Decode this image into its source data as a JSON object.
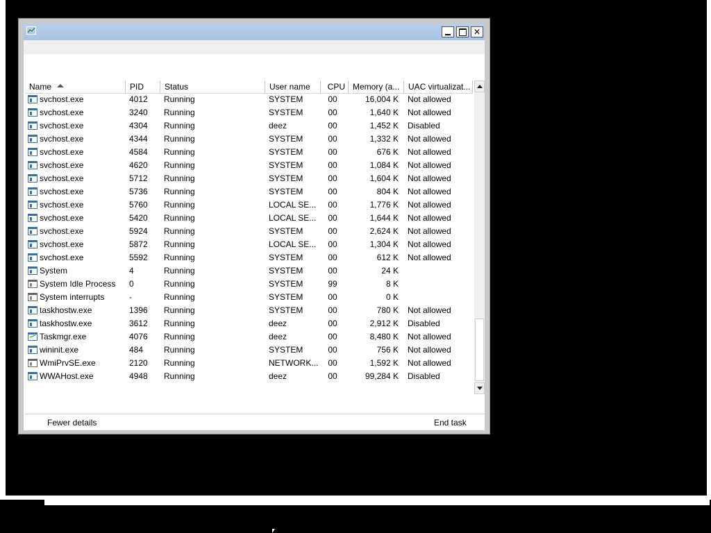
{
  "window": {
    "title": "",
    "minimize_symbol": "",
    "maximize_symbol": "",
    "close_symbol": "✕"
  },
  "columns": [
    {
      "label": "Name",
      "sorted": "ascending"
    },
    {
      "label": "PID"
    },
    {
      "label": "Status"
    },
    {
      "label": "User name"
    },
    {
      "label": "CPU"
    },
    {
      "label": "Memory (a..."
    },
    {
      "label": "UAC virtualizat..."
    }
  ],
  "processes": [
    {
      "icon": "window-icon",
      "name": "svchost.exe",
      "pid": "4012",
      "status": "Running",
      "user": "SYSTEM",
      "cpu": "00",
      "memory": "16,004 K",
      "uac": "Not allowed"
    },
    {
      "icon": "window-icon",
      "name": "svchost.exe",
      "pid": "3240",
      "status": "Running",
      "user": "SYSTEM",
      "cpu": "00",
      "memory": "1,640 K",
      "uac": "Not allowed"
    },
    {
      "icon": "window-icon",
      "name": "svchost.exe",
      "pid": "4304",
      "status": "Running",
      "user": "deez",
      "cpu": "00",
      "memory": "1,452 K",
      "uac": "Disabled"
    },
    {
      "icon": "window-icon",
      "name": "svchost.exe",
      "pid": "4344",
      "status": "Running",
      "user": "SYSTEM",
      "cpu": "00",
      "memory": "1,332 K",
      "uac": "Not allowed"
    },
    {
      "icon": "window-icon",
      "name": "svchost.exe",
      "pid": "4584",
      "status": "Running",
      "user": "SYSTEM",
      "cpu": "00",
      "memory": "676 K",
      "uac": "Not allowed"
    },
    {
      "icon": "window-icon",
      "name": "svchost.exe",
      "pid": "4620",
      "status": "Running",
      "user": "SYSTEM",
      "cpu": "00",
      "memory": "1,084 K",
      "uac": "Not allowed"
    },
    {
      "icon": "window-icon",
      "name": "svchost.exe",
      "pid": "5712",
      "status": "Running",
      "user": "SYSTEM",
      "cpu": "00",
      "memory": "1,604 K",
      "uac": "Not allowed"
    },
    {
      "icon": "window-icon",
      "name": "svchost.exe",
      "pid": "5736",
      "status": "Running",
      "user": "SYSTEM",
      "cpu": "00",
      "memory": "804 K",
      "uac": "Not allowed"
    },
    {
      "icon": "window-icon",
      "name": "svchost.exe",
      "pid": "5760",
      "status": "Running",
      "user": "LOCAL SE...",
      "cpu": "00",
      "memory": "1,776 K",
      "uac": "Not allowed"
    },
    {
      "icon": "window-icon",
      "name": "svchost.exe",
      "pid": "5420",
      "status": "Running",
      "user": "LOCAL SE...",
      "cpu": "00",
      "memory": "1,644 K",
      "uac": "Not allowed"
    },
    {
      "icon": "window-icon",
      "name": "svchost.exe",
      "pid": "5924",
      "status": "Running",
      "user": "SYSTEM",
      "cpu": "00",
      "memory": "2,624 K",
      "uac": "Not allowed"
    },
    {
      "icon": "window-icon",
      "name": "svchost.exe",
      "pid": "5872",
      "status": "Running",
      "user": "LOCAL SE...",
      "cpu": "00",
      "memory": "1,304 K",
      "uac": "Not allowed"
    },
    {
      "icon": "window-icon",
      "name": "svchost.exe",
      "pid": "5592",
      "status": "Running",
      "user": "SYSTEM",
      "cpu": "00",
      "memory": "612 K",
      "uac": "Not allowed"
    },
    {
      "icon": "window-icon",
      "name": "System",
      "pid": "4",
      "status": "Running",
      "user": "SYSTEM",
      "cpu": "00",
      "memory": "24 K",
      "uac": ""
    },
    {
      "icon": "gray-window-icon",
      "name": "System Idle Process",
      "pid": "0",
      "status": "Running",
      "user": "SYSTEM",
      "cpu": "99",
      "memory": "8 K",
      "uac": ""
    },
    {
      "icon": "gray-window-icon",
      "name": "System interrupts",
      "pid": "-",
      "status": "Running",
      "user": "SYSTEM",
      "cpu": "00",
      "memory": "0 K",
      "uac": ""
    },
    {
      "icon": "window-icon",
      "name": "taskhostw.exe",
      "pid": "1396",
      "status": "Running",
      "user": "SYSTEM",
      "cpu": "00",
      "memory": "780 K",
      "uac": "Not allowed"
    },
    {
      "icon": "window-icon",
      "name": "taskhostw.exe",
      "pid": "3612",
      "status": "Running",
      "user": "deez",
      "cpu": "00",
      "memory": "2,912 K",
      "uac": "Disabled"
    },
    {
      "icon": "chart-icon",
      "name": "Taskmgr.exe",
      "pid": "4076",
      "status": "Running",
      "user": "deez",
      "cpu": "00",
      "memory": "8,480 K",
      "uac": "Not allowed"
    },
    {
      "icon": "window-icon",
      "name": "wininit.exe",
      "pid": "484",
      "status": "Running",
      "user": "SYSTEM",
      "cpu": "00",
      "memory": "756 K",
      "uac": "Not allowed"
    },
    {
      "icon": "gray-window-icon",
      "name": "WmiPrvSE.exe",
      "pid": "2120",
      "status": "Running",
      "user": "NETWORK...",
      "cpu": "00",
      "memory": "1,592 K",
      "uac": "Not allowed"
    },
    {
      "icon": "window-icon",
      "name": "WWAHost.exe",
      "pid": "4948",
      "status": "Running",
      "user": "deez",
      "cpu": "00",
      "memory": "99,284 K",
      "uac": "Disabled"
    }
  ],
  "footer": {
    "fewer_details": "Fewer details",
    "end_task": "End task"
  },
  "colors": {
    "titlebar": "#aac4e3",
    "icon_blue": "#3a6ea5",
    "window_frame": "#c9c9c9"
  }
}
